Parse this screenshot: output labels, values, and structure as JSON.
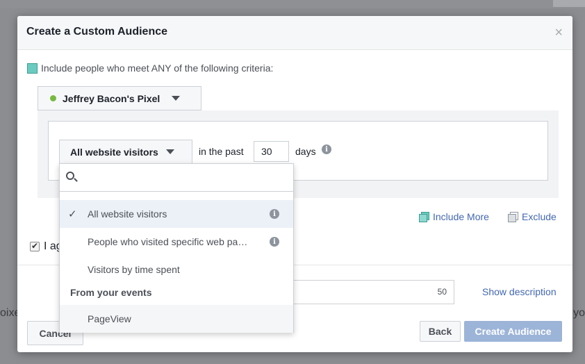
{
  "modal": {
    "title": "Create a Custom Audience",
    "close": "×"
  },
  "criteria": {
    "label": "Include people who meet ANY of the following criteria:"
  },
  "pixel": {
    "name": "Jeffrey Bacon's Pixel",
    "status_color": "#76b93f"
  },
  "rule": {
    "selected_option": "All website visitors",
    "in_the_past": "in the past",
    "days_value": "30",
    "days_label": "days"
  },
  "dropdown": {
    "search_placeholder": "",
    "options": [
      {
        "label": "All website visitors",
        "selected": true,
        "info": true
      },
      {
        "label": "People who visited specific web pa…",
        "selected": false,
        "info": true
      },
      {
        "label": "Visitors by time spent",
        "selected": false,
        "info": false
      }
    ],
    "events_heading": "From your events",
    "event_options": [
      {
        "label": "PageView"
      }
    ]
  },
  "actions": {
    "include_more": "Include More",
    "exclude": "Exclude"
  },
  "agree": {
    "label": "I ag"
  },
  "description": {
    "char_count": "50",
    "show_description": "Show description"
  },
  "footer": {
    "cancel": "Cancel",
    "back": "Back",
    "create": "Create Audience"
  },
  "background": {
    "left_fragment": "oixe",
    "right_fragment": "yo"
  },
  "colors": {
    "accent": "#4267b2",
    "teal": "#6bcbc0",
    "create_button_disabled": "#9cb4d8"
  }
}
